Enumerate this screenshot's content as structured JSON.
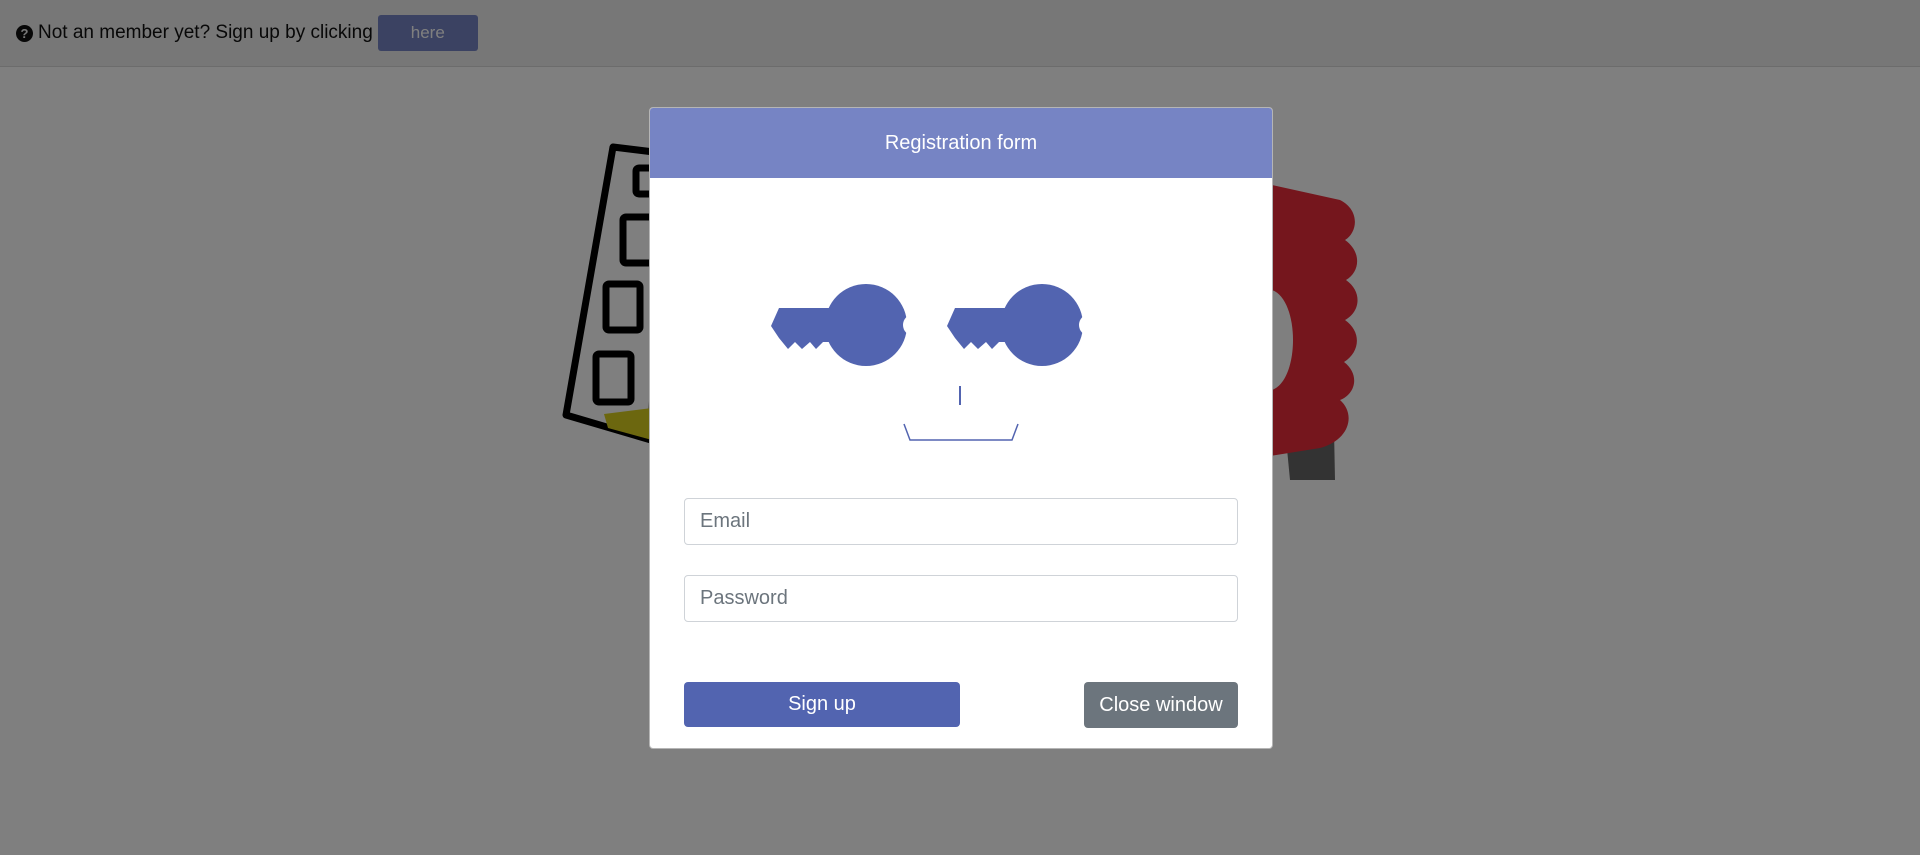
{
  "topbar": {
    "message": "Not an member yet? Sign up by clicking",
    "here_label": "here",
    "icon": "question-circle-icon"
  },
  "modal": {
    "title": "Registration form",
    "illustration_icon": "keys-face-icon",
    "email_placeholder": "Email",
    "password_placeholder": "Password",
    "signup_label": "Sign up",
    "close_label": "Close window"
  },
  "colors": {
    "primary": "#5264b0",
    "header": "#7684c4",
    "secondary": "#6c757d",
    "overlay": "rgba(0,0,0,0.5)"
  }
}
